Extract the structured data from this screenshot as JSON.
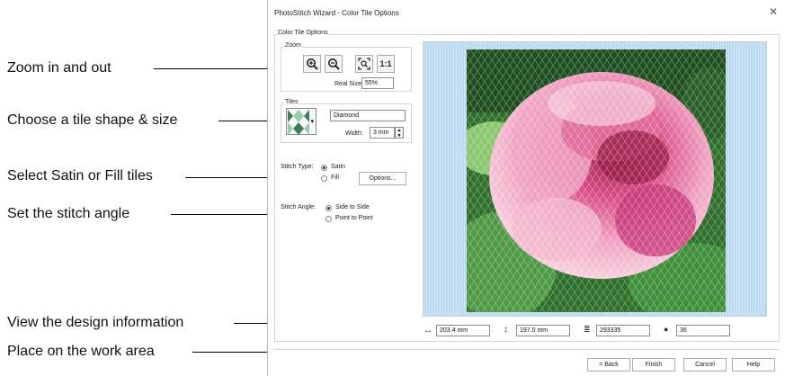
{
  "callouts": {
    "zoom": "Zoom in and out",
    "tile": "Choose a tile shape & size",
    "stitch_type": "Select Satin or Fill tiles",
    "stitch_angle": "Set the stitch angle",
    "design_info": "View the design information",
    "work_area": "Place on the work area"
  },
  "dialog": {
    "title": "PhotoStitch Wizard - Color Tile Options",
    "group_label": "Color Tile Options",
    "zoom": {
      "label": "Zoom",
      "one_to_one": "1:1",
      "real_size_label": "Real Size",
      "zoom_value": "55%"
    },
    "tiles": {
      "label": "Tiles",
      "shape_name": "Diamond",
      "width_label": "Width:",
      "width_value": "3 mm"
    },
    "stitch_type": {
      "label": "Stitch Type:",
      "options": [
        "Satin",
        "Fill"
      ],
      "selected": "Satin",
      "options_button": "Options..."
    },
    "stitch_angle": {
      "label": "Stitch Angle:",
      "options": [
        "Side to Side",
        "Point to Point"
      ],
      "selected": "Side to Side"
    },
    "info": {
      "width": "203.4 mm",
      "height": "197.0 mm",
      "stitches": "293335",
      "colors": "36"
    },
    "buttons": {
      "back": "< Back",
      "finish": "Finish",
      "cancel": "Cancel",
      "help": "Help"
    }
  },
  "colors": {
    "rose_light": "#f4b8cd",
    "rose_mid": "#e06c9a",
    "rose_dark": "#9b1f4a",
    "leaf_dark": "#1f4f1f",
    "leaf_mid": "#3f8f3a",
    "leaf_light": "#8bc66e",
    "background_blue": "#bcd9f2"
  },
  "icons": {
    "zoom_in": "zoom-in-icon",
    "zoom_out": "zoom-out-icon",
    "fit": "zoom-fit-icon",
    "width": "width-arrow-icon",
    "height": "height-arrow-icon",
    "stitches": "stitch-count-icon",
    "colors": "palette-icon",
    "tile_shape": "diamond-tile-icon"
  }
}
